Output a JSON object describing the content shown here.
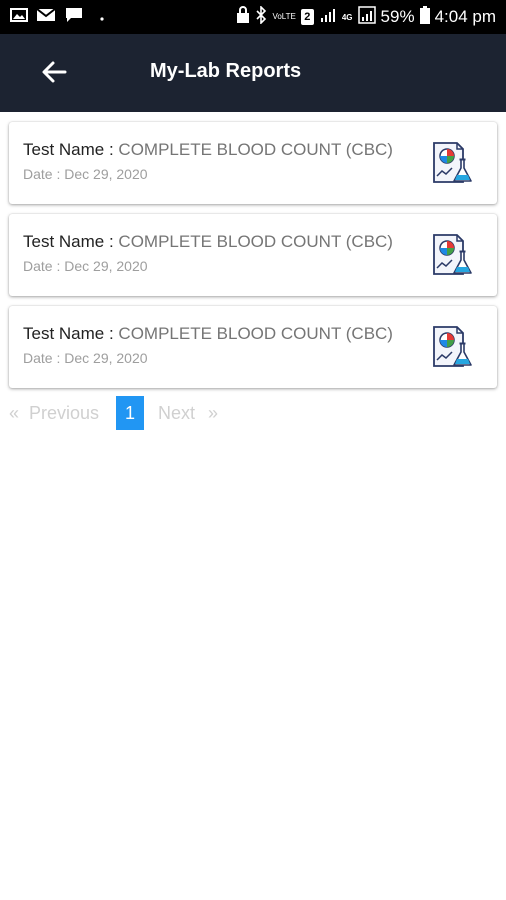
{
  "status_bar": {
    "battery": "59%",
    "time": "4:04 pm",
    "network_4g": "4G",
    "volte": "VoLTE",
    "sim_badge": "2",
    "left_icons": [
      "image-icon",
      "mail-icon",
      "chat-icon",
      "dot-icon"
    ],
    "right_icons": [
      "lock-icon",
      "bluetooth-icon",
      "volte-icon",
      "sim-icon",
      "signal-icon",
      "4g-icon",
      "battery-icon"
    ]
  },
  "header": {
    "title": "My-Lab Reports",
    "back_icon": "arrow-left-icon",
    "background": "#1c2331"
  },
  "reports": [
    {
      "name_label": "Test Name : ",
      "name_value": "COMPLETE BLOOD COUNT (CBC)",
      "date_label": "Date : ",
      "date_value": "Dec 29, 2020",
      "icon": "lab-report-icon"
    },
    {
      "name_label": "Test Name : ",
      "name_value": "COMPLETE BLOOD COUNT (CBC)",
      "date_label": "Date : ",
      "date_value": "Dec 29, 2020",
      "icon": "lab-report-icon"
    },
    {
      "name_label": "Test Name : ",
      "name_value": "COMPLETE BLOOD COUNT (CBC)",
      "date_label": "Date : ",
      "date_value": "Dec 29, 2020",
      "icon": "lab-report-icon"
    }
  ],
  "pagination": {
    "prev_arrow": "«",
    "prev_label": "Previous",
    "current_page": "1",
    "next_label": "Next",
    "next_arrow": "»",
    "active_color": "#2196f3"
  }
}
